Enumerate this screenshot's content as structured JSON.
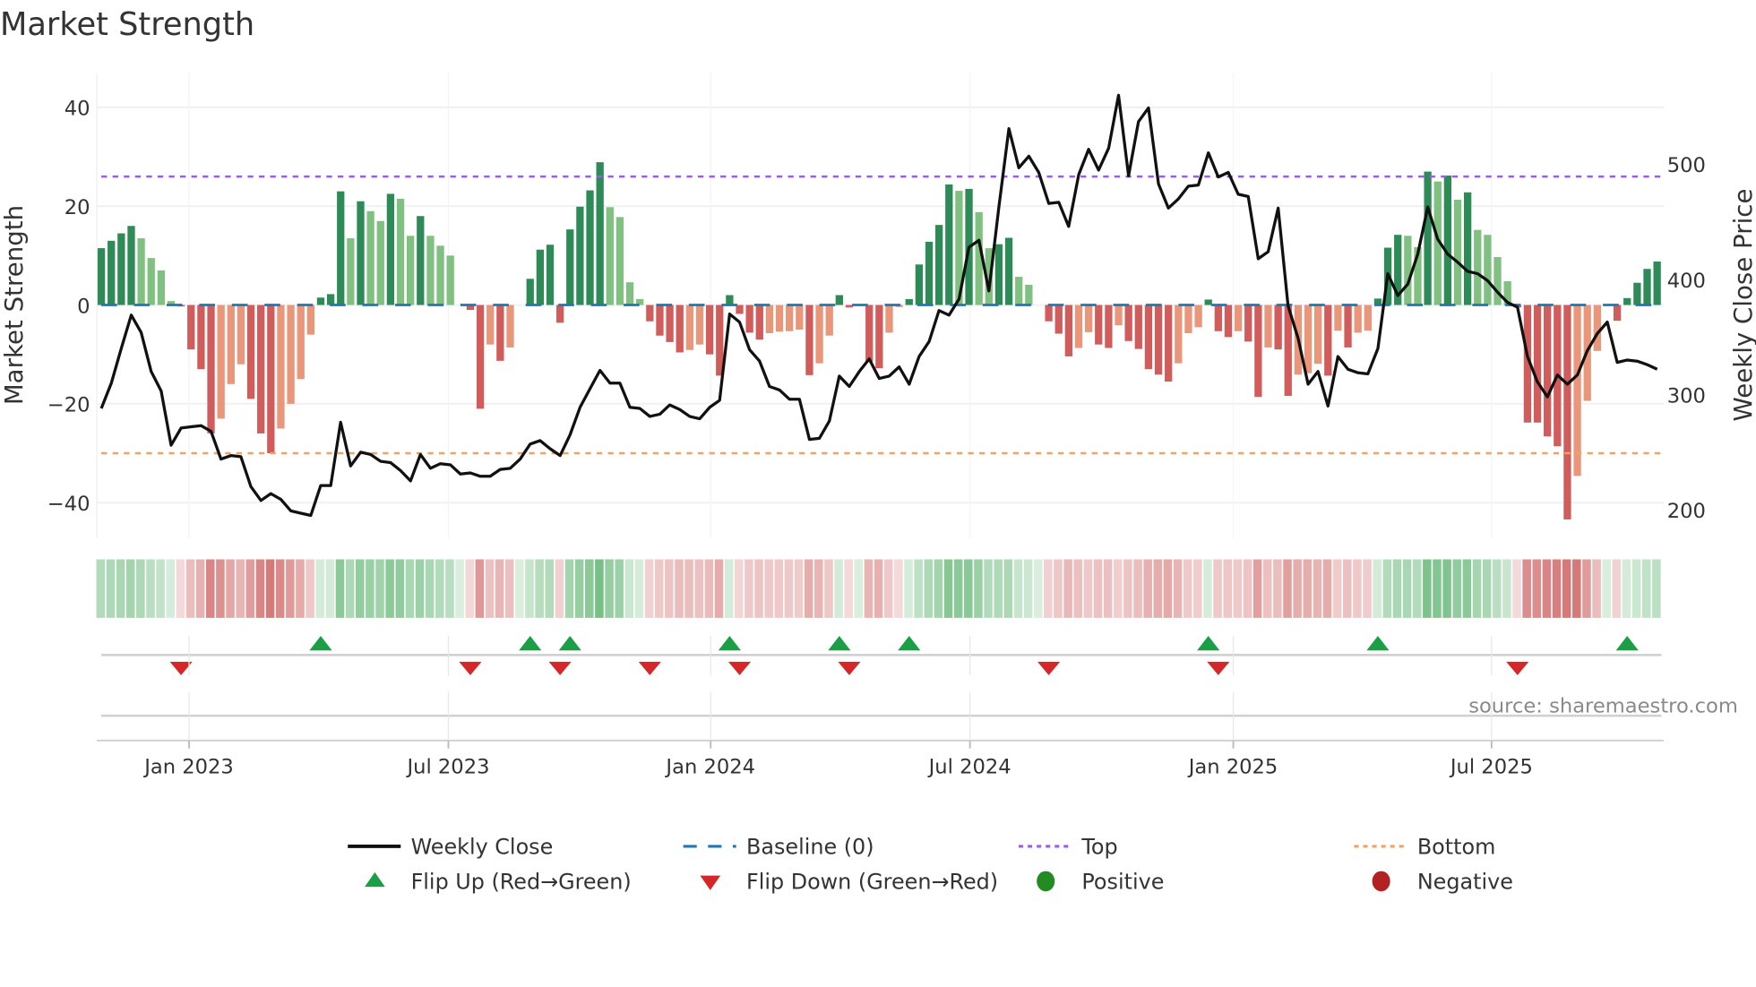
{
  "chart_data": {
    "type": "bar",
    "title": "Market Strength",
    "ylabel": "Market Strength",
    "y2label": "Weekly Close Price",
    "ylim": [
      -47,
      47
    ],
    "y2lim": [
      175,
      579
    ],
    "yticks": [
      40,
      20,
      0,
      -20,
      -40
    ],
    "yticklabels": [
      "40",
      "20",
      "0",
      "−20",
      "−40"
    ],
    "y2ticks": [
      500,
      400,
      300,
      200
    ],
    "y2ticklabels": [
      "500",
      "400",
      "300",
      "200"
    ],
    "grid": true,
    "top_level": 26,
    "bottom_level": -30,
    "baseline": 0,
    "x_unit": "week index",
    "xticks": [
      {
        "week": 9.8,
        "label": "Jan 2023"
      },
      {
        "week": 35.8,
        "label": "Jul 2023"
      },
      {
        "week": 62.1,
        "label": "Jan 2024"
      },
      {
        "week": 88.1,
        "label": "Jul 2024"
      },
      {
        "week": 114.5,
        "label": "Jan 2025"
      },
      {
        "week": 140.4,
        "label": "Jul 2025"
      }
    ],
    "strength": [
      11.5,
      13,
      14.5,
      16,
      13.5,
      9.5,
      7,
      0.8,
      -0.3,
      -9,
      -13,
      -26,
      -23,
      -16,
      -12,
      -19,
      -26,
      -30,
      -25,
      -20,
      -15,
      -6,
      1.5,
      2.2,
      23,
      13.5,
      21,
      19,
      17,
      22.5,
      21.5,
      14,
      18,
      14,
      12,
      10,
      0,
      -1,
      -21,
      -8,
      -11.3,
      -8.6,
      0,
      5.3,
      11.2,
      12.2,
      -3.6,
      15.3,
      19.9,
      23.2,
      28.9,
      19.8,
      17.8,
      4.6,
      1.2,
      -3.3,
      -6.2,
      -7.5,
      -9.6,
      -9.1,
      -8,
      -10,
      -14.3,
      2,
      -1.8,
      -5.6,
      -7,
      -5.7,
      -5.4,
      -5.3,
      -5,
      -14.2,
      -11.8,
      -6.2,
      2,
      -0.5,
      0,
      -11.5,
      -12.8,
      -5.6,
      -0.4,
      1.2,
      8.2,
      12.8,
      16.2,
      24.4,
      23.1,
      23.5,
      18.8,
      11.5,
      12.3,
      13.6,
      5.7,
      4.1,
      0,
      -3.3,
      -5.8,
      -10.4,
      -8.7,
      -5.5,
      -8,
      -8.7,
      -4.1,
      -7.3,
      -8.9,
      -13,
      -14.1,
      -15.5,
      -11.8,
      -5.7,
      -4.5,
      1.1,
      -5.3,
      -6.5,
      -5.3,
      -7.4,
      -18.6,
      -8.6,
      -9,
      -18.4,
      -14.1,
      -13.8,
      -11.9,
      -14.3,
      -5.2,
      -8.6,
      -5.6,
      -5.2,
      1.3,
      11.6,
      14.2,
      14,
      11.7,
      27,
      25,
      26.2,
      21.3,
      22.8,
      15.2,
      14.2,
      9.7,
      4.8,
      -0.5,
      -23.8,
      -23.8,
      -26.6,
      -28.6,
      -43.4,
      -34.6,
      -19.4,
      -9.3,
      0,
      -3.2,
      1.4,
      4.5,
      7.3,
      8.8
    ],
    "weekly_close": [
      288,
      310,
      340,
      369,
      354,
      320,
      303,
      256,
      271,
      272,
      273,
      268,
      244,
      247,
      246,
      220,
      208,
      214,
      209,
      199,
      197,
      195,
      221,
      221,
      276,
      238,
      250,
      248,
      242,
      241,
      234,
      225,
      248,
      236,
      240,
      239,
      231,
      232,
      229,
      229,
      235,
      236,
      244,
      257,
      260,
      253,
      247,
      265,
      289,
      305,
      321,
      310,
      310,
      289,
      288,
      281,
      283,
      291,
      287,
      281,
      279,
      289,
      295,
      370,
      363,
      339,
      329,
      307,
      304,
      296,
      296,
      261,
      262,
      277,
      316,
      307,
      320,
      331,
      314,
      316,
      324,
      309,
      333,
      346,
      373,
      369,
      383,
      428,
      434,
      390,
      463,
      531,
      497,
      507,
      493,
      466,
      467,
      446,
      491,
      513,
      495,
      514,
      560,
      490,
      537,
      549,
      483,
      462,
      470,
      481,
      482,
      510,
      489,
      493,
      474,
      472,
      418,
      424,
      462,
      377,
      349,
      309,
      320,
      290,
      333,
      322,
      319,
      318,
      340,
      405,
      386,
      396,
      422,
      463,
      435,
      422,
      415,
      407,
      405,
      399,
      389,
      380,
      376,
      333,
      311,
      298,
      317,
      309,
      317,
      338,
      353,
      363,
      328,
      330,
      329,
      326,
      322
    ],
    "flip_up_weeks": [
      23,
      44,
      48,
      64,
      75,
      82,
      112,
      129,
      154
    ],
    "flip_down_weeks": [
      9,
      38,
      47,
      56,
      65,
      76,
      96,
      113,
      143
    ],
    "legend": {
      "placement": "bottom",
      "items": [
        {
          "label": "Weekly Close",
          "kind": "line"
        },
        {
          "label": "Baseline (0)",
          "kind": "dash"
        },
        {
          "label": "Top",
          "kind": "dot"
        },
        {
          "label": "Bottom",
          "kind": "dot"
        },
        {
          "label": "Flip Up (Red→Green)",
          "kind": "tri-up"
        },
        {
          "label": "Flip Down (Green→Red)",
          "kind": "tri-down"
        },
        {
          "label": "Positive",
          "kind": "circle"
        },
        {
          "label": "Negative",
          "kind": "circle"
        }
      ]
    },
    "source": "source: sharemaestro.com"
  },
  "colors": {
    "pos_strong": "#2e8b57",
    "pos_weak": "#80c080",
    "neg_strong": "#d15c5c",
    "neg_weak": "#e9967a",
    "strip_pos": "#55b068",
    "strip_neg": "#cd5c5c",
    "line": "#111111",
    "baseline": "#1f77b4",
    "top": "#9b5de5",
    "bottom": "#f4a261",
    "flip_up": "#1a9e46",
    "flip_down": "#d62728",
    "positive": "#228b22",
    "negative": "#b22222"
  }
}
